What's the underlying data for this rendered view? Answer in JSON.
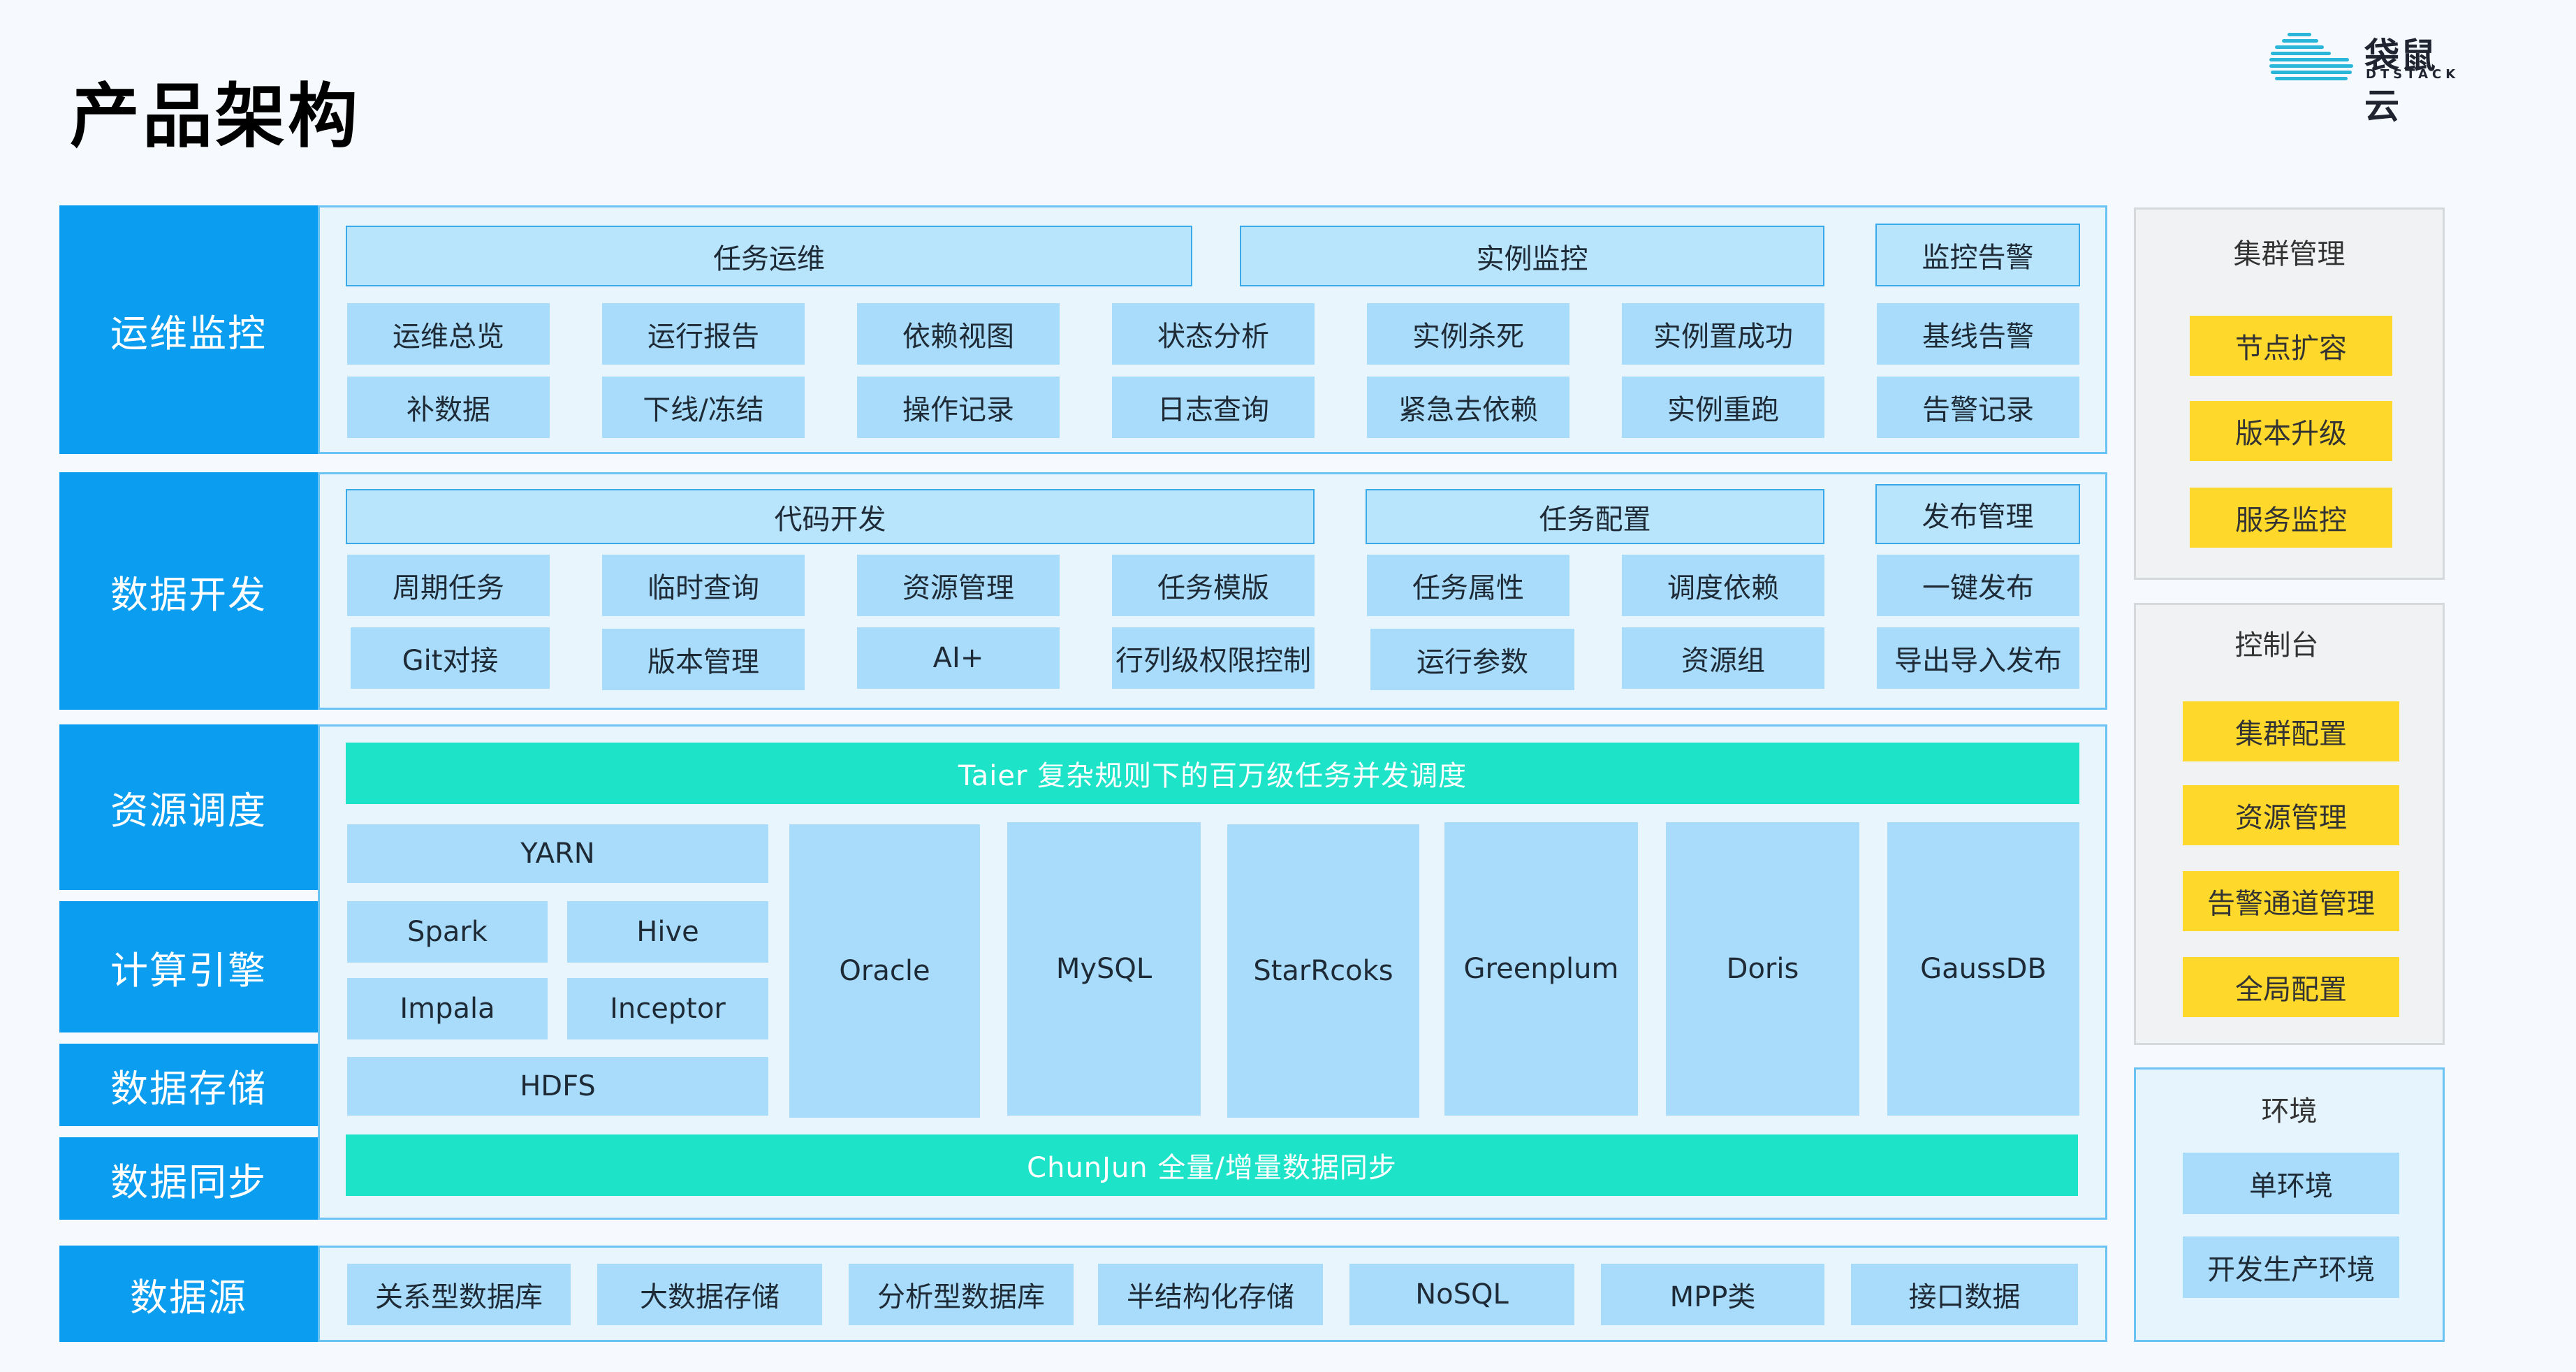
{
  "page_title": "产品架构",
  "logo": {
    "name": "袋鼠云",
    "sub": "DTSTACK"
  },
  "colors": {
    "primary_blue": "#0a9df0",
    "cell_blue": "#a8dcfa",
    "teal": "#1de3c8",
    "yellow": "#fed82a"
  },
  "rows": {
    "ops": {
      "label": "运维监控",
      "groups": [
        "任务运维",
        "实例监控",
        "监控告警"
      ],
      "line1": [
        "运维总览",
        "运行报告",
        "依赖视图",
        "状态分析",
        "实例杀死",
        "实例置成功",
        "基线告警"
      ],
      "line2": [
        "补数据",
        "下线/冻结",
        "操作记录",
        "日志查询",
        "紧急去依赖",
        "实例重跑",
        "告警记录"
      ]
    },
    "dev": {
      "label": "数据开发",
      "groups": [
        "代码开发",
        "任务配置",
        "发布管理"
      ],
      "line1": [
        "周期任务",
        "临时查询",
        "资源管理",
        "任务模版",
        "任务属性",
        "调度依赖",
        "一键发布"
      ],
      "line2": [
        "Git对接",
        "版本管理",
        "AI+",
        "行列级权限控制",
        "运行参数",
        "资源组",
        "导出导入发布"
      ]
    },
    "engine": {
      "labels": [
        "资源调度",
        "计算引擎",
        "数据存储",
        "数据同步"
      ],
      "taier": "Taier 复杂规则下的百万级任务并发调度",
      "chunjun": "ChunJun 全量/增量数据同步",
      "yarn": "YARN",
      "spark": "Spark",
      "hive": "Hive",
      "impala": "Impala",
      "inceptor": "Inceptor",
      "hdfs": "HDFS",
      "dbs": [
        "Oracle",
        "MySQL",
        "StarRcoks",
        "Greenplum",
        "Doris",
        "GaussDB"
      ]
    },
    "source": {
      "label": "数据源",
      "items": [
        "关系型数据库",
        "大数据存储",
        "分析型数据库",
        "半结构化存储",
        "NoSQL",
        "MPP类",
        "接口数据"
      ]
    }
  },
  "side": {
    "cluster": {
      "title": "集群管理",
      "items": [
        "节点扩容",
        "版本升级",
        "服务监控"
      ]
    },
    "console": {
      "title": "控制台",
      "items": [
        "集群配置",
        "资源管理",
        "告警通道管理",
        "全局配置"
      ]
    },
    "env": {
      "title": "环境",
      "items": [
        "单环境",
        "开发生产环境"
      ]
    }
  }
}
